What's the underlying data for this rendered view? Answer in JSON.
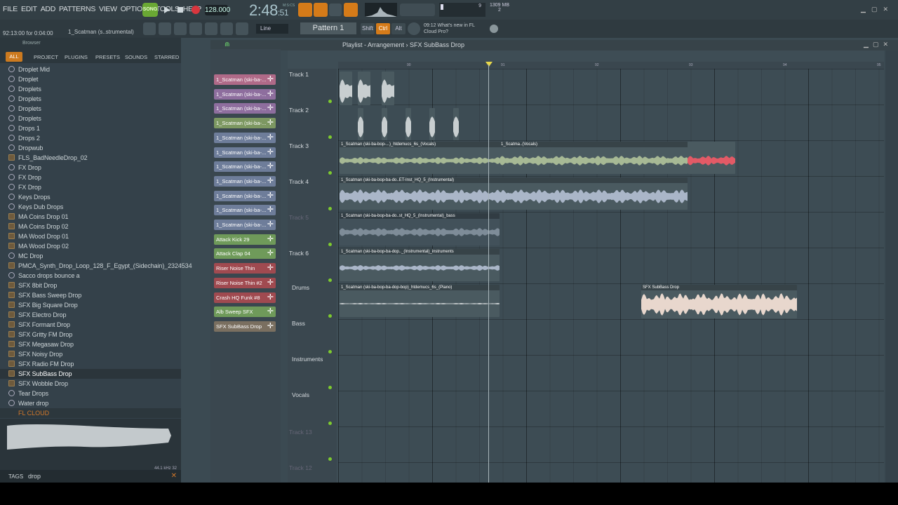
{
  "menu": [
    "FILE",
    "EDIT",
    "ADD",
    "PATTERNS",
    "VIEW",
    "OPTIONS",
    "TOOLS",
    "HELP"
  ],
  "transport": {
    "song_label": "SONG",
    "tempo": "128.000",
    "time_main": "2:48",
    "time_sub": ":51",
    "time_mode": "M:S:CS"
  },
  "system": {
    "ram": "1309 MB",
    "cpu_value": "9",
    "poly": "2"
  },
  "hint": {
    "time": "92:13:00 for 0:04:00",
    "channel": "1_Scatman (s..strumental)"
  },
  "toolbar": {
    "snap": "Line",
    "pattern": "Pattern 1",
    "shift": "Shift",
    "ctrl": "Ctrl",
    "alt": "Alt",
    "news_time": "09:12",
    "news_line1": "What's new in FL",
    "news_line2": "Cloud Pro?"
  },
  "browser": {
    "title": "Browser",
    "tabs": [
      "ALL",
      "PROJECT",
      "PLUGINS",
      "PRESETS",
      "SOUNDS",
      "STARRED"
    ],
    "items": [
      {
        "label": "Droplet Mid",
        "type": "sound"
      },
      {
        "label": "Droplet",
        "type": "sound"
      },
      {
        "label": "Droplets",
        "type": "sound"
      },
      {
        "label": "Droplets",
        "type": "sound"
      },
      {
        "label": "Droplets",
        "type": "sound"
      },
      {
        "label": "Droplets",
        "type": "sound"
      },
      {
        "label": "Drops 1",
        "type": "sound"
      },
      {
        "label": "Drops 2",
        "type": "sound"
      },
      {
        "label": "Dropwub",
        "type": "sound"
      },
      {
        "label": "FLS_BadNeedleDrop_02",
        "type": "file"
      },
      {
        "label": "FX Drop",
        "type": "sound"
      },
      {
        "label": "FX Drop",
        "type": "sound"
      },
      {
        "label": "FX Drop",
        "type": "sound"
      },
      {
        "label": "Keys Drops",
        "type": "sound"
      },
      {
        "label": "Keys Dub Drops",
        "type": "sound"
      },
      {
        "label": "MA Coins Drop 01",
        "type": "file"
      },
      {
        "label": "MA Coins Drop 02",
        "type": "file"
      },
      {
        "label": "MA Wood Drop 01",
        "type": "file"
      },
      {
        "label": "MA Wood Drop 02",
        "type": "file"
      },
      {
        "label": "MC Drop",
        "type": "sound"
      },
      {
        "label": "PMCA_Synth_Drop_Loop_128_F_Egypt_(Sidechain)_2324534",
        "type": "file"
      },
      {
        "label": "Sacco drops bounce a",
        "type": "sound"
      },
      {
        "label": "SFX 8bit Drop",
        "type": "file"
      },
      {
        "label": "SFX Bass Sweep Drop",
        "type": "file"
      },
      {
        "label": "SFX Big Square Drop",
        "type": "file"
      },
      {
        "label": "SFX Electro Drop",
        "type": "file"
      },
      {
        "label": "SFX Formant Drop",
        "type": "file"
      },
      {
        "label": "SFX Gritty FM Drop",
        "type": "file"
      },
      {
        "label": "SFX Megasaw Drop",
        "type": "file"
      },
      {
        "label": "SFX Noisy Drop",
        "type": "file"
      },
      {
        "label": "SFX Radio FM Drop",
        "type": "file"
      },
      {
        "label": "SFX SubBass Drop",
        "type": "file",
        "selected": true
      },
      {
        "label": "SFX Wobble Drop",
        "type": "file"
      },
      {
        "label": "Tear Drops",
        "type": "sound"
      },
      {
        "label": "Water drop",
        "type": "sound"
      }
    ],
    "cloud_label": "FL CLOUD",
    "preview_info": "44.1 kHz 32",
    "tags_label": "TAGS",
    "search_value": "drop"
  },
  "channels": [
    {
      "label": "1_Scatman (ski-ba-...",
      "color": "#b06a88"
    },
    {
      "label": "1_Scatman (ski-ba-...",
      "color": "#8e6e9e"
    },
    {
      "label": "1_Scatman (ski-ba-...",
      "color": "#8e6e9e"
    },
    {
      "label": "1_Scatman (ski-ba-...",
      "color": "#7d9862"
    },
    {
      "label": "1_Scatman (ski-ba-...",
      "color": "#6e7d9a"
    },
    {
      "label": "1_Scatman (ski-ba-...",
      "color": "#6e7d9a"
    },
    {
      "label": "1_Scatman (ski-ba-...",
      "color": "#6e7d9a"
    },
    {
      "label": "1_Scatman (ski-ba-...",
      "color": "#6e7d9a"
    },
    {
      "label": "1_Scatman (ski-ba-...",
      "color": "#6e7d9a"
    },
    {
      "label": "1_Scatman (ski-ba-...",
      "color": "#6e7d9a"
    },
    {
      "label": "1_Scatman (ski-ba-...",
      "color": "#6e7d9a"
    },
    {
      "label": "Attack Kick 29",
      "color": "#6f9a5a"
    },
    {
      "label": "Attack Clap 04",
      "color": "#6f9a5a"
    },
    {
      "label": "Riser Noise Thin",
      "color": "#a04a50"
    },
    {
      "label": "Riser Noise Thin #2",
      "color": "#a04a50"
    },
    {
      "label": "Crash HQ Funk #8",
      "color": "#a04a50"
    },
    {
      "label": "Alb Sweep SFX",
      "color": "#6f9a5a"
    },
    {
      "label": "SFX SubBass Drop",
      "color": "#7a6f60"
    }
  ],
  "playlist": {
    "breadcrumb": "Playlist - Arrangement › SFX SubBass Drop",
    "ruler": [
      "90",
      "91",
      "92",
      "93",
      "94",
      "95"
    ],
    "tracks": [
      "Track 1",
      "Track 2",
      "Track 3",
      "Track 4",
      "Track 5",
      "Track 6",
      "Drums",
      "Bass",
      "Instruments",
      "Vocals",
      "Track 13",
      "Track 12"
    ],
    "clips": {
      "t3": "1_Scatman (ski-ba-bop-...)_htdemucs_6s_(Vocals)",
      "t3b": "1_Scatma..(Vocals)",
      "t4": "1_Scatman (ski-ba-bop-ba-do..ET-Inst_HQ_5_(Instrumental)",
      "t5": "1_Scatman (ski-ba-bop-ba-do..st_HQ_5_(Instrumental)_bass",
      "t6": "1_Scatman (ski-ba-bop-ba-dop.._(Instrumental)_instruments",
      "t7": "1_Scatman (ski-ba-bop-ba-dop-bop)_htdemucs_6s_(Piano)",
      "sub": "SFX SubBass Drop"
    }
  },
  "colors": {
    "accent": "#d57b19",
    "song": "#6aa834",
    "clip_vocal": "#a7b995",
    "clip_red": "#e25a66",
    "clip_inst": "#aab6c8",
    "clip_sub": "#e8d7cd"
  }
}
